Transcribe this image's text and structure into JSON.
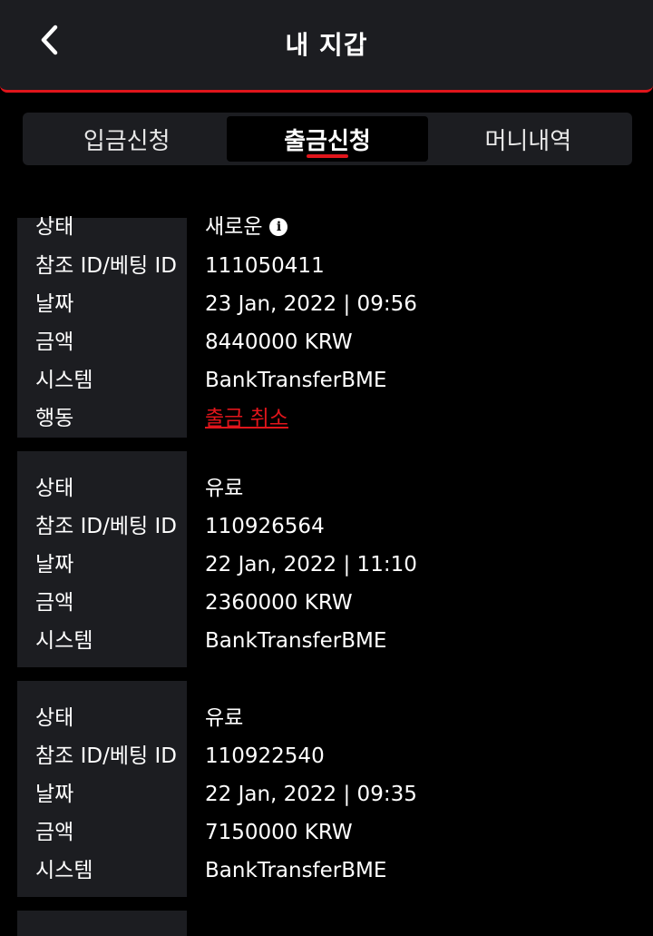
{
  "header": {
    "title": "내 지갑",
    "back_icon": "chevron-left-icon"
  },
  "tabs": [
    {
      "label": "입금신청",
      "active": false
    },
    {
      "label": "출금신청",
      "active": true
    },
    {
      "label": "머니내역",
      "active": false
    }
  ],
  "labels": {
    "status": "상태",
    "ref_id": "참조 ID/베팅 ID",
    "date": "날짜",
    "amount": "금액",
    "system": "시스템",
    "action": "행동"
  },
  "records": [
    {
      "status": "새로운",
      "ref_id": "111050411",
      "date": "23 Jan, 2022 | 09:56",
      "amount": "8440000 KRW",
      "system": "BankTransferBME",
      "action": "출금 취소"
    },
    {
      "status": "유료",
      "ref_id": "110926564",
      "date": "22 Jan, 2022 | 11:10",
      "amount": "2360000 KRW",
      "system": "BankTransferBME"
    },
    {
      "status": "유료",
      "ref_id": "110922540",
      "date": "22 Jan, 2022 | 09:35",
      "amount": "7150000 KRW",
      "system": "BankTransferBME"
    }
  ],
  "colors": {
    "accent": "#e0151b",
    "panel": "#1c1d21",
    "background": "#000000"
  }
}
